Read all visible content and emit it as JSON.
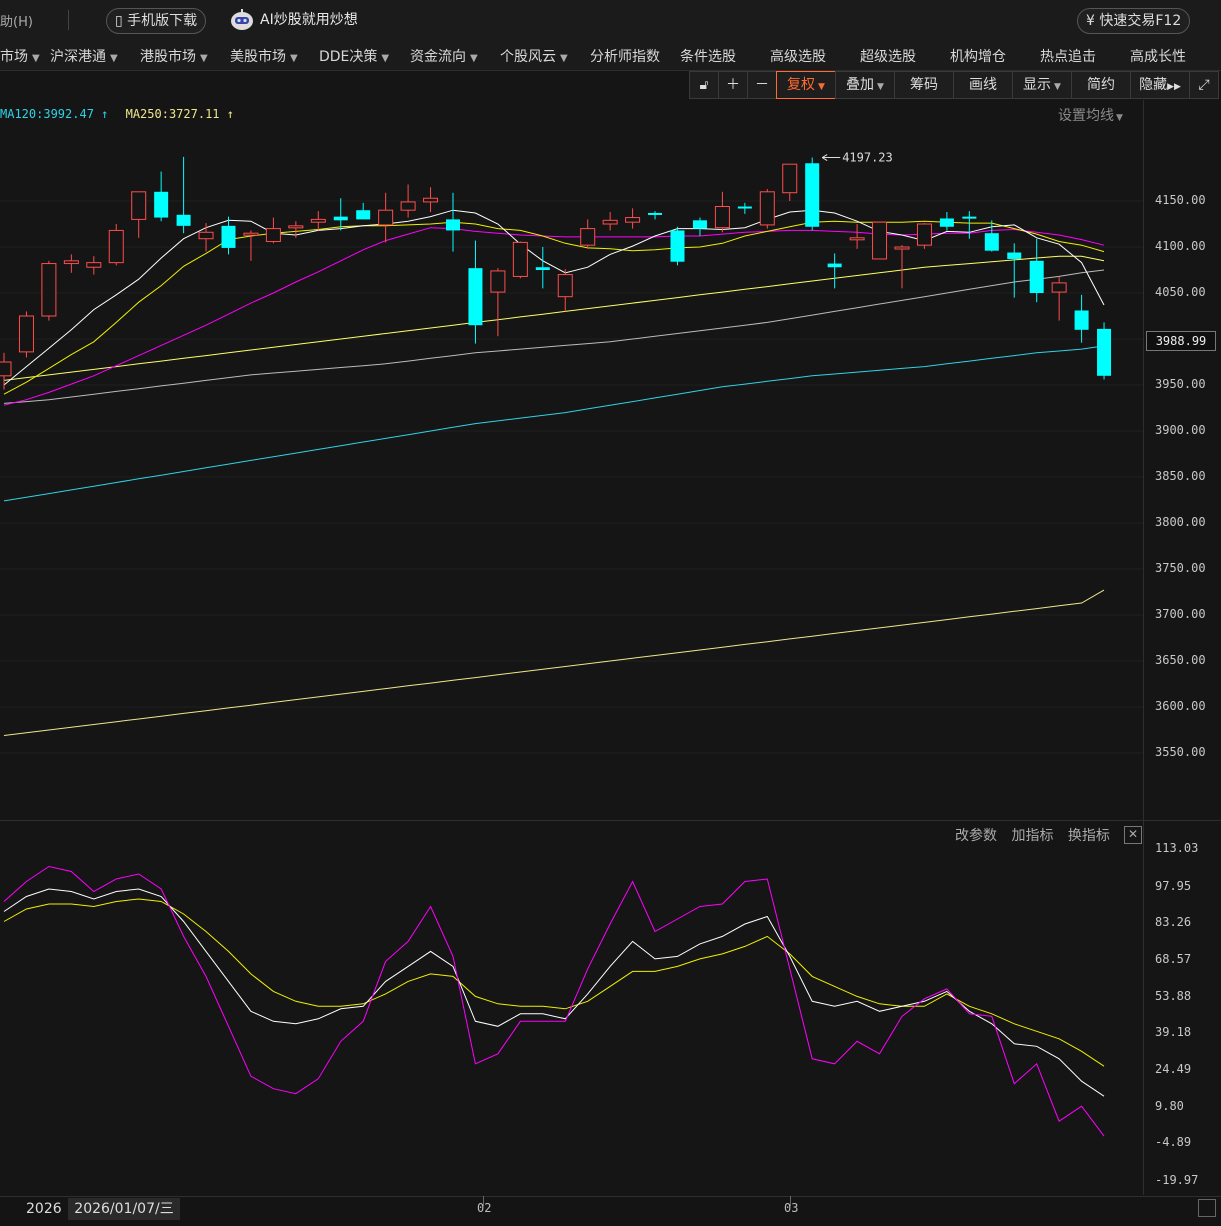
{
  "topbar": {
    "help_label": "助(H)",
    "mobile_download": "手机版下载",
    "ai_banner": "AI炒股就用炒想",
    "fast_trade": "快速交易F12"
  },
  "nav": {
    "items": [
      {
        "label": "市场",
        "caret": true
      },
      {
        "label": "沪深港通",
        "caret": true
      },
      {
        "label": "港股市场",
        "caret": true
      },
      {
        "label": "美股市场",
        "caret": true
      },
      {
        "label": "DDE决策",
        "caret": true
      },
      {
        "label": "资金流向",
        "caret": true
      },
      {
        "label": "个股风云",
        "caret": true
      },
      {
        "label": "分析师指数",
        "caret": false
      },
      {
        "label": "条件选股",
        "caret": false
      },
      {
        "label": "高级选股",
        "caret": false
      },
      {
        "label": "超级选股",
        "caret": false
      },
      {
        "label": "机构增仓",
        "caret": false
      },
      {
        "label": "热点追击",
        "caret": false
      },
      {
        "label": "高成长性",
        "caret": false
      }
    ]
  },
  "toolbar": {
    "fuquan": "复权",
    "overlay": "叠加",
    "chips": "筹码",
    "draw": "画线",
    "display": "显示",
    "simple": "简约",
    "hide": "隐藏"
  },
  "ma_legend": {
    "ma120": "MA120:3992.47 ↑",
    "ma250": "MA250:3727.11 ↑",
    "settings": "设置均线"
  },
  "price_axis": {
    "ticks": [
      "4150.00",
      "4100.00",
      "4050.00",
      "3950.00",
      "3900.00",
      "3850.00",
      "3800.00",
      "3750.00",
      "3700.00",
      "3650.00",
      "3600.00",
      "3550.00"
    ],
    "current_price": "3988.99",
    "high_annotation": "4197.23"
  },
  "indicator_panel": {
    "change_params": "改参数",
    "add_indicator": "加指标",
    "switch_indicator": "换指标",
    "ticks": [
      "113.03",
      "97.95",
      "83.26",
      "68.57",
      "53.88",
      "39.18",
      "24.49",
      "9.80",
      "-4.89",
      "-19.97"
    ]
  },
  "bottom": {
    "year": "2026",
    "date": "2026/01/07/三",
    "months": [
      "02",
      "03"
    ]
  },
  "colors": {
    "up": "#ff4d4d",
    "down": "#00ffff",
    "accent": "#ff6a2f",
    "ma5": "#ffffff",
    "ma10": "#f0f000",
    "ma20": "#ff00ff",
    "ma60": "#ffff66",
    "ma120": "#2fd3e6",
    "ma250": "#f0e68c"
  },
  "chart_data": {
    "type": "candlestick",
    "price_range": [
      3515,
      4239
    ],
    "candles": [
      {
        "o": 3960,
        "h": 3985,
        "l": 3945,
        "c": 3975
      },
      {
        "o": 3986,
        "h": 4030,
        "l": 3980,
        "c": 4025
      },
      {
        "o": 4025,
        "h": 4085,
        "l": 4020,
        "c": 4082
      },
      {
        "o": 4082,
        "h": 4092,
        "l": 4072,
        "c": 4085
      },
      {
        "o": 4078,
        "h": 4090,
        "l": 4070,
        "c": 4083
      },
      {
        "o": 4083,
        "h": 4125,
        "l": 4080,
        "c": 4118
      },
      {
        "o": 4130,
        "h": 4158,
        "l": 4110,
        "c": 4160
      },
      {
        "o": 4160,
        "h": 4182,
        "l": 4128,
        "c": 4132
      },
      {
        "o": 4135,
        "h": 4198,
        "l": 4115,
        "c": 4123
      },
      {
        "o": 4109,
        "h": 4126,
        "l": 4095,
        "c": 4116
      },
      {
        "o": 4123,
        "h": 4133,
        "l": 4092,
        "c": 4099
      },
      {
        "o": 4115,
        "h": 4118,
        "l": 4085,
        "c": 4115
      },
      {
        "o": 4106,
        "h": 4132,
        "l": 4104,
        "c": 4120
      },
      {
        "o": 4123,
        "h": 4128,
        "l": 4110,
        "c": 4123
      },
      {
        "o": 4127,
        "h": 4139,
        "l": 4118,
        "c": 4130
      },
      {
        "o": 4133,
        "h": 4153,
        "l": 4118,
        "c": 4129
      },
      {
        "o": 4140,
        "h": 4148,
        "l": 4132,
        "c": 4130
      },
      {
        "o": 4124,
        "h": 4159,
        "l": 4105,
        "c": 4140
      },
      {
        "o": 4140,
        "h": 4168,
        "l": 4132,
        "c": 4149
      },
      {
        "o": 4149,
        "h": 4165,
        "l": 4138,
        "c": 4153
      },
      {
        "o": 4130,
        "h": 4159,
        "l": 4095,
        "c": 4118
      },
      {
        "o": 4077,
        "h": 4107,
        "l": 3995,
        "c": 4015
      },
      {
        "o": 4051,
        "h": 4077,
        "l": 4003,
        "c": 4074
      },
      {
        "o": 4068,
        "h": 4106,
        "l": 4066,
        "c": 4105
      },
      {
        "o": 4078,
        "h": 4100,
        "l": 4055,
        "c": 4075
      },
      {
        "o": 4046,
        "h": 4076,
        "l": 4030,
        "c": 4070
      },
      {
        "o": 4102,
        "h": 4130,
        "l": 4098,
        "c": 4120
      },
      {
        "o": 4125,
        "h": 4138,
        "l": 4118,
        "c": 4129
      },
      {
        "o": 4127,
        "h": 4142,
        "l": 4120,
        "c": 4132
      },
      {
        "o": 4137,
        "h": 4139,
        "l": 4130,
        "c": 4135
      },
      {
        "o": 4118,
        "h": 4122,
        "l": 4080,
        "c": 4084
      },
      {
        "o": 4129,
        "h": 4132,
        "l": 4112,
        "c": 4120
      },
      {
        "o": 4121,
        "h": 4160,
        "l": 4116,
        "c": 4144
      },
      {
        "o": 4144,
        "h": 4148,
        "l": 4136,
        "c": 4142
      },
      {
        "o": 4124,
        "h": 4163,
        "l": 4120,
        "c": 4160
      },
      {
        "o": 4159,
        "h": 4180,
        "l": 4150,
        "c": 4190
      },
      {
        "o": 4191,
        "h": 4197.23,
        "l": 4118,
        "c": 4122
      },
      {
        "o": 4082,
        "h": 4093,
        "l": 4055,
        "c": 4078
      },
      {
        "o": 4110,
        "h": 4125,
        "l": 4098,
        "c": 4110
      },
      {
        "o": 4087,
        "h": 4124,
        "l": 4087,
        "c": 4127
      },
      {
        "o": 4100,
        "h": 4102,
        "l": 4055,
        "c": 4100
      },
      {
        "o": 4102,
        "h": 4126,
        "l": 4098,
        "c": 4125
      },
      {
        "o": 4131,
        "h": 4138,
        "l": 4118,
        "c": 4122
      },
      {
        "o": 4133,
        "h": 4139,
        "l": 4109,
        "c": 4131
      },
      {
        "o": 4115,
        "h": 4129,
        "l": 4095,
        "c": 4096
      },
      {
        "o": 4094,
        "h": 4104,
        "l": 4045,
        "c": 4087
      },
      {
        "o": 4085,
        "h": 4109,
        "l": 4040,
        "c": 4050
      },
      {
        "o": 4051,
        "h": 4068,
        "l": 4020,
        "c": 4061
      },
      {
        "o": 4031,
        "h": 4048,
        "l": 3996,
        "c": 4010
      },
      {
        "o": 4011,
        "h": 4018,
        "l": 3956,
        "c": 3960
      }
    ],
    "ma5": [
      3950,
      3970,
      3990,
      4010,
      4032,
      4048,
      4065,
      4088,
      4109,
      4121,
      4129,
      4128,
      4115,
      4113,
      4118,
      4120,
      4123,
      4125,
      4128,
      4133,
      4140,
      4137,
      4125,
      4103,
      4085,
      4072,
      4078,
      4092,
      4101,
      4112,
      4120,
      4120,
      4119,
      4121,
      4130,
      4138,
      4140,
      4137,
      4128,
      4117,
      4113,
      4107,
      4117,
      4116,
      4122,
      4124,
      4110,
      4103,
      4083,
      4037
    ],
    "ma10": [
      3940,
      3953,
      3968,
      3983,
      3997,
      4018,
      4040,
      4058,
      4079,
      4093,
      4108,
      4112,
      4115,
      4117,
      4119,
      4122,
      4123,
      4123,
      4124,
      4125,
      4127,
      4125,
      4120,
      4118,
      4112,
      4104,
      4099,
      4098,
      4096,
      4097,
      4099,
      4100,
      4104,
      4112,
      4117,
      4122,
      4127,
      4128,
      4127,
      4127,
      4127,
      4128,
      4127,
      4126,
      4126,
      4120,
      4114,
      4106,
      4102,
      4095
    ],
    "ma20": [
      3928,
      3934,
      3942,
      3951,
      3960,
      3971,
      3982,
      3993,
      4004,
      4015,
      4027,
      4039,
      4050,
      4062,
      4073,
      4085,
      4097,
      4107,
      4114,
      4121,
      4120,
      4117,
      4115,
      4113,
      4112,
      4111,
      4111,
      4111,
      4111,
      4111,
      4112,
      4112,
      4114,
      4116,
      4117,
      4118,
      4118,
      4117,
      4116,
      4114,
      4113,
      4114,
      4115,
      4115,
      4118,
      4119,
      4116,
      4113,
      4108,
      4102
    ],
    "ma60": [
      3955,
      3958,
      3961,
      3964,
      3967,
      3970,
      3973,
      3976,
      3979,
      3982,
      3985,
      3988,
      3991,
      3994,
      3997,
      4000,
      4003,
      4006,
      4009,
      4012,
      4015,
      4018,
      4021,
      4024,
      4027,
      4030,
      4033,
      4036,
      4039,
      4042,
      4045,
      4048,
      4051,
      4054,
      4057,
      4060,
      4063,
      4066,
      4069,
      4072,
      4075,
      4078,
      4080,
      4082,
      4084,
      4086,
      4088,
      4090,
      4090,
      4085
    ],
    "ma_gray": [
      3930,
      3932,
      3934,
      3937,
      3940,
      3943,
      3946,
      3949,
      3952,
      3955,
      3958,
      3961,
      3963,
      3965,
      3967,
      3969,
      3971,
      3973,
      3976,
      3979,
      3982,
      3985,
      3987,
      3989,
      3991,
      3993,
      3995,
      3997,
      4000,
      4003,
      4006,
      4009,
      4012,
      4015,
      4018,
      4022,
      4026,
      4030,
      4034,
      4038,
      4042,
      4046,
      4050,
      4054,
      4058,
      4062,
      4065,
      4068,
      4072,
      4075
    ],
    "ma120": [
      3824,
      3828,
      3832,
      3836,
      3840,
      3844,
      3848,
      3852,
      3856,
      3860,
      3864,
      3868,
      3872,
      3876,
      3880,
      3884,
      3888,
      3892,
      3896,
      3900,
      3904,
      3908,
      3911,
      3914,
      3917,
      3920,
      3924,
      3928,
      3932,
      3936,
      3940,
      3944,
      3948,
      3951,
      3954,
      3957,
      3960,
      3962,
      3964,
      3966,
      3968,
      3970,
      3973,
      3976,
      3979,
      3982,
      3985,
      3987,
      3989,
      3992.47
    ],
    "ma250": [
      3569,
      3572,
      3575,
      3578,
      3581,
      3584,
      3587,
      3590,
      3593,
      3596,
      3599,
      3602,
      3605,
      3608,
      3611,
      3614,
      3617,
      3620,
      3623,
      3626,
      3629,
      3632,
      3635,
      3638,
      3641,
      3644,
      3647,
      3650,
      3653,
      3656,
      3659,
      3662,
      3665,
      3668,
      3671,
      3674,
      3677,
      3680,
      3683,
      3686,
      3689,
      3692,
      3695,
      3698,
      3701,
      3704,
      3707,
      3710,
      3713,
      3727.11
    ],
    "indicator": {
      "range": [
        -19.97,
        113.03
      ],
      "fast": [
        92,
        100,
        106,
        104,
        96,
        101,
        103,
        97,
        78,
        62,
        42,
        22,
        17,
        15,
        21,
        36,
        44,
        68,
        76,
        90,
        70,
        27,
        31,
        44,
        44,
        44,
        65,
        83,
        100,
        80,
        85,
        90,
        91,
        100,
        101,
        65,
        29,
        27,
        36,
        31,
        46,
        53,
        57,
        47,
        46,
        19,
        27,
        4,
        10,
        -2
      ],
      "mid": [
        88,
        94,
        97,
        96,
        93,
        96,
        97,
        94,
        84,
        72,
        60,
        48,
        44,
        43,
        45,
        49,
        50,
        60,
        66,
        72,
        66,
        44,
        42,
        47,
        47,
        45,
        55,
        66,
        76,
        69,
        70,
        75,
        78,
        83,
        86,
        70,
        52,
        50,
        52,
        48,
        50,
        52,
        56,
        48,
        43,
        35,
        34,
        29,
        20,
        14
      ],
      "slow": [
        84,
        89,
        91,
        91,
        90,
        92,
        93,
        92,
        87,
        80,
        72,
        63,
        56,
        52,
        50,
        50,
        51,
        55,
        60,
        63,
        62,
        54,
        51,
        50,
        50,
        49,
        52,
        58,
        64,
        64,
        66,
        69,
        71,
        74,
        78,
        71,
        62,
        58,
        54,
        51,
        50,
        50,
        55,
        50,
        47,
        43,
        40,
        37,
        32,
        26
      ]
    }
  }
}
